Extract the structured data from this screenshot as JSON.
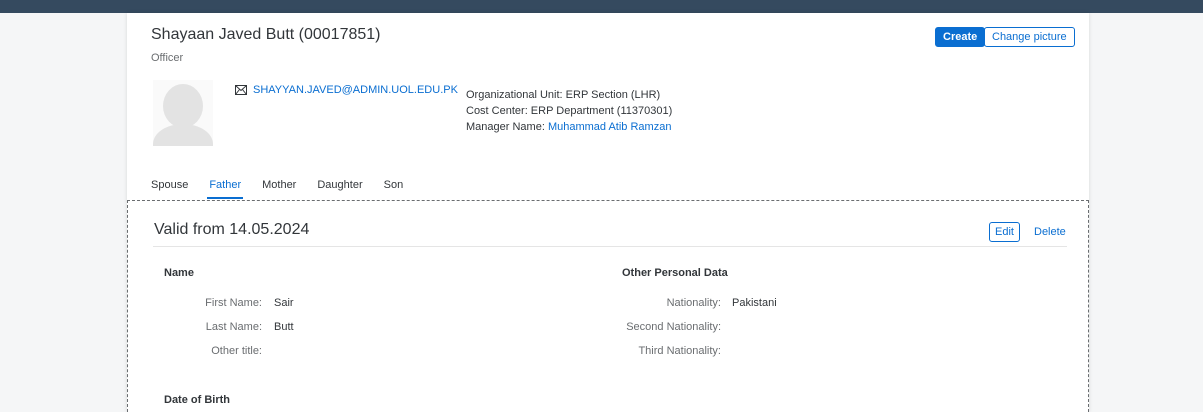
{
  "header": {
    "name": "Shayaan Javed Butt (00017851)",
    "position": "Officer",
    "create_label": "Create",
    "change_picture_label": "Change picture",
    "email": "SHAYYAN.JAVED@ADMIN.UOL.EDU.PK",
    "org_unit": "Organizational Unit: ERP Section (LHR)",
    "cost_center": "Cost Center: ERP Department (11370301)",
    "manager_label": "Manager Name:",
    "manager_name": "Muhammad Atib Ramzan"
  },
  "tabs": [
    {
      "label": "Spouse",
      "active": false
    },
    {
      "label": "Father",
      "active": true
    },
    {
      "label": "Mother",
      "active": false
    },
    {
      "label": "Daughter",
      "active": false
    },
    {
      "label": "Son",
      "active": false
    }
  ],
  "section": {
    "title": "Valid from 14.05.2024",
    "edit_label": "Edit",
    "delete_label": "Delete",
    "name_group": {
      "title": "Name",
      "first_name_label": "First Name:",
      "first_name_value": "Sair",
      "last_name_label": "Last Name:",
      "last_name_value": "Butt",
      "other_title_label": "Other title:",
      "other_title_value": ""
    },
    "other_group": {
      "title": "Other Personal Data",
      "nationality_label": "Nationality:",
      "nationality_value": "Pakistani",
      "second_nationality_label": "Second Nationality:",
      "third_nationality_label": "Third Nationality:"
    },
    "dob_group": {
      "title": "Date of Birth"
    }
  },
  "colors": {
    "accent": "#0a6ed1",
    "topbar": "#354a5f"
  },
  "icons": {
    "email": "envelope-icon",
    "avatar": "person-placeholder"
  }
}
